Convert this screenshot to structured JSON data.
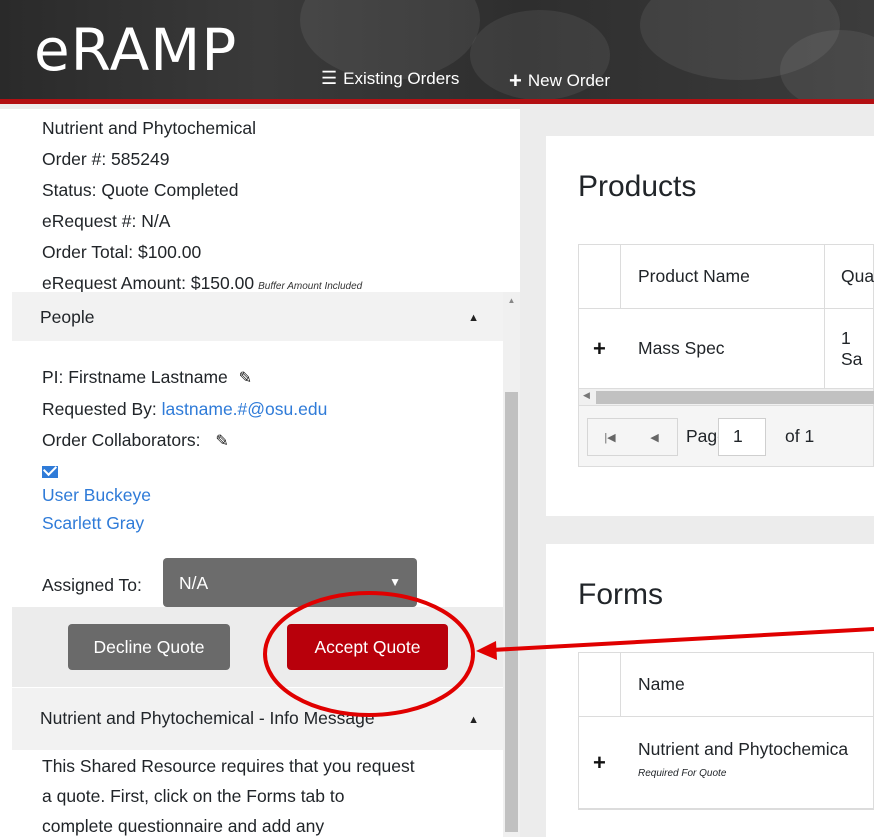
{
  "header": {
    "logo": "eRAMP",
    "nav": [
      {
        "label": "Existing Orders",
        "icon": "list-icon"
      },
      {
        "label": "New Order",
        "icon": "plus-icon"
      }
    ]
  },
  "summary": {
    "lines": [
      "Nutrient and Phytochemical",
      "Order #: 585249",
      "Status: Quote Completed",
      "eRequest #: N/A",
      "Order Total: $100.00"
    ],
    "erequest_amount": "eRequest Amount: $150.00",
    "buffer_note": "Buffer Amount Included"
  },
  "people": {
    "section_title": "People",
    "pi_label": "PI:",
    "pi_name": "Firstname Lastname",
    "requested_by_label": "Requested By:",
    "requested_by_email": "lastname.#@osu.edu",
    "collaborators_label": "Order Collaborators:",
    "collaborators": [
      "User Buckeye",
      "Scarlett Gray"
    ],
    "assigned_label": "Assigned To:",
    "assigned_value": "N/A"
  },
  "actions": {
    "decline_label": "Decline Quote",
    "accept_label": "Accept Quote"
  },
  "info": {
    "section_title": "Nutrient and Phytochemical - Info Message",
    "lines": [
      "This Shared Resource requires that you request",
      "a quote. First, click on the Forms tab to",
      "complete questionnaire and add any"
    ]
  },
  "products": {
    "title": "Products",
    "columns": [
      "Product Name",
      "Qua"
    ],
    "rows": [
      {
        "name": "Mass Spec",
        "qty": "1 Sa"
      }
    ],
    "pager": {
      "page_label": "Page",
      "page_value": "1",
      "of_label": "of 1"
    }
  },
  "forms": {
    "title": "Forms",
    "columns": [
      "Name"
    ],
    "rows": [
      {
        "name": "Nutrient and Phytochemica",
        "note": "Required For Quote"
      }
    ]
  },
  "colors": {
    "accent_red": "#b8000b",
    "header_border": "#b30f12",
    "link_blue": "#2f7bd8",
    "annotation_red": "#e00000"
  }
}
